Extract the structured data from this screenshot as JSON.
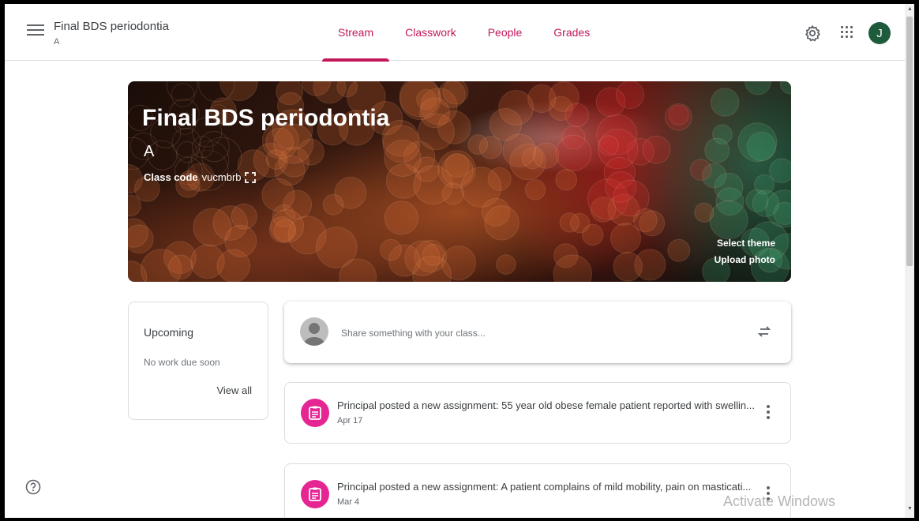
{
  "header": {
    "class_title": "Final BDS periodontia",
    "class_section": "A",
    "tabs": [
      {
        "label": "Stream",
        "active": true
      },
      {
        "label": "Classwork",
        "active": false
      },
      {
        "label": "People",
        "active": false
      },
      {
        "label": "Grades",
        "active": false
      }
    ],
    "avatar_letter": "J",
    "accent_color": "#c2185b",
    "avatar_color": "#1e5a3c"
  },
  "banner": {
    "title": "Final BDS periodontia",
    "section": "A",
    "class_code_label": "Class code",
    "class_code": "vucmbrb",
    "select_theme": "Select theme",
    "upload_photo": "Upload photo"
  },
  "upcoming": {
    "title": "Upcoming",
    "empty_text": "No work due soon",
    "view_all": "View all"
  },
  "share": {
    "placeholder": "Share something with your class..."
  },
  "posts": [
    {
      "text": "Principal posted a new assignment: 55 year old obese female patient reported with swellin...",
      "date": "Apr 17"
    },
    {
      "text": "Principal posted a new assignment: A patient complains of mild mobility, pain on masticati...",
      "date": "Mar 4"
    }
  ],
  "watermark": "Activate Windows",
  "icons": {
    "menu": "menu-icon",
    "settings": "gear-icon",
    "apps": "apps-grid-icon",
    "copy_code": "fullscreen-icon",
    "repost": "repost-icon",
    "assignment": "assignment-icon",
    "more": "more-vert-icon",
    "help": "help-icon"
  }
}
